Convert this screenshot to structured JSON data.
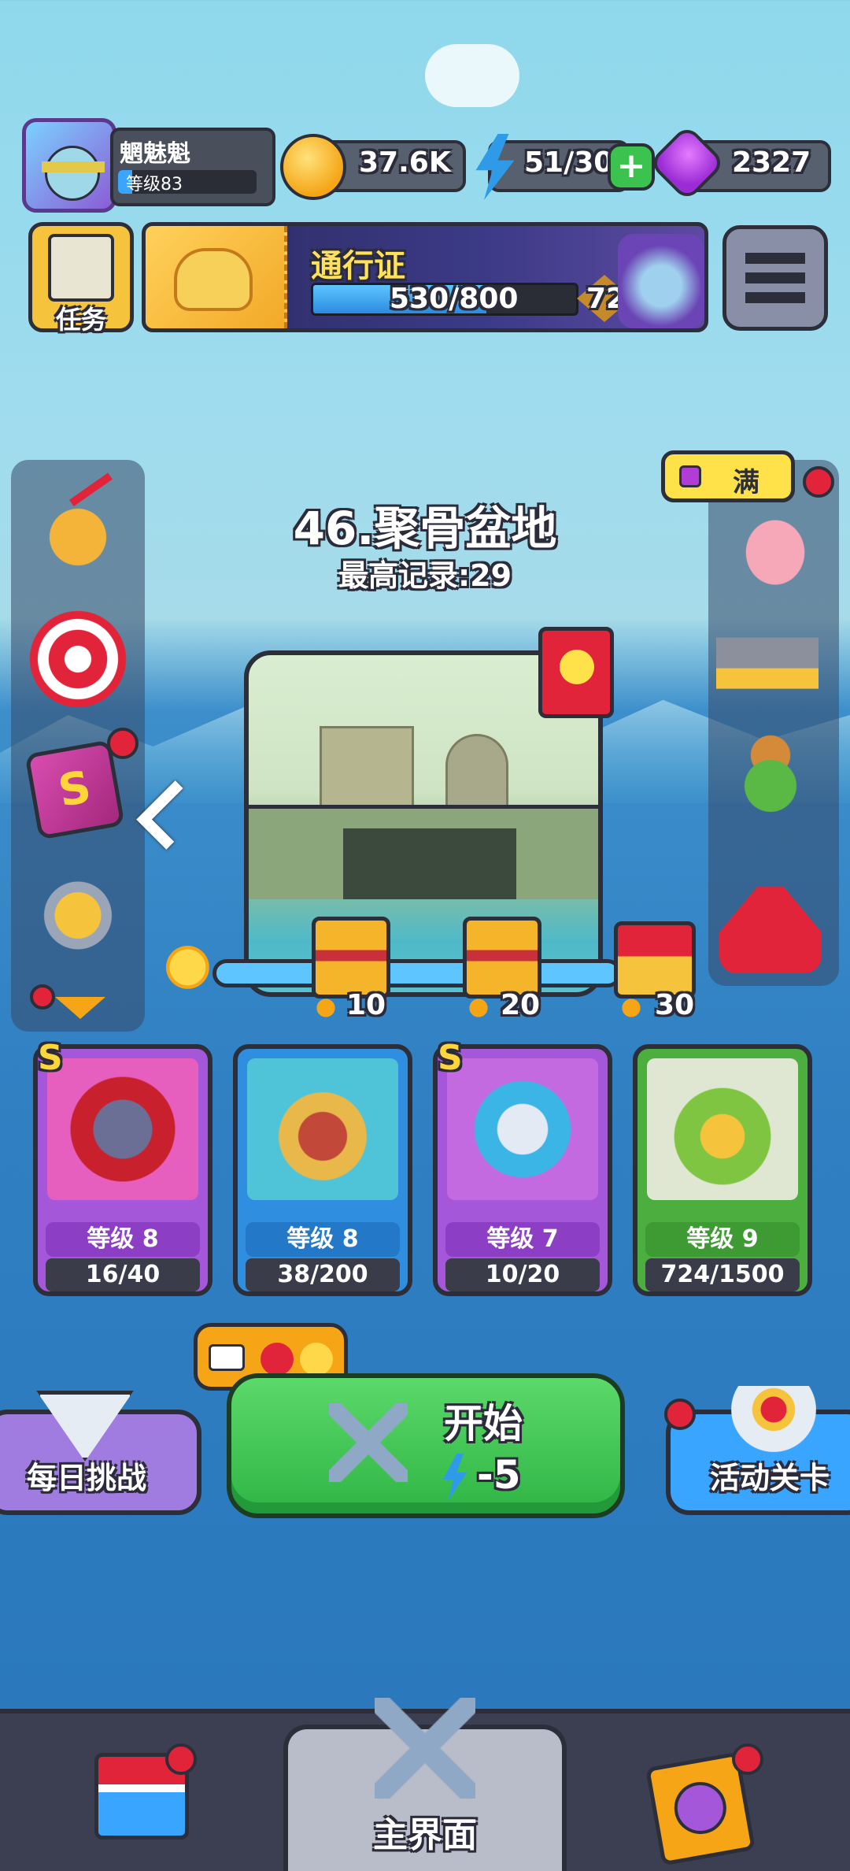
{
  "profile": {
    "name": "魍魅魁",
    "level_label": "等级83"
  },
  "resources": {
    "coins": "37.6K",
    "energy": "51/30",
    "gems": "2327"
  },
  "task_label": "任务",
  "pass": {
    "title": "通行证",
    "progress": "530/800",
    "level": "72"
  },
  "stage": {
    "title": "46.聚骨盆地",
    "record": "最高记录:29"
  },
  "piggy_bank_label": "满",
  "chest_milestones": [
    "10",
    "20",
    "30"
  ],
  "heroes": [
    {
      "level": "等级 8",
      "fragments": "16/40",
      "rank": "S",
      "color": "#a457d9"
    },
    {
      "level": "等级 8",
      "fragments": "38/200",
      "rank": "",
      "color": "#2f8ee0"
    },
    {
      "level": "等级 7",
      "fragments": "10/20",
      "rank": "S",
      "color": "#a457d9"
    },
    {
      "level": "等级 9",
      "fragments": "724/1500",
      "rank": "",
      "color": "#4cae3e"
    }
  ],
  "daily_challenge_label": "每日挑战",
  "start": {
    "label": "开始",
    "cost": "-5"
  },
  "event_label": "活动关卡",
  "nav": {
    "home_label": "主界面"
  }
}
